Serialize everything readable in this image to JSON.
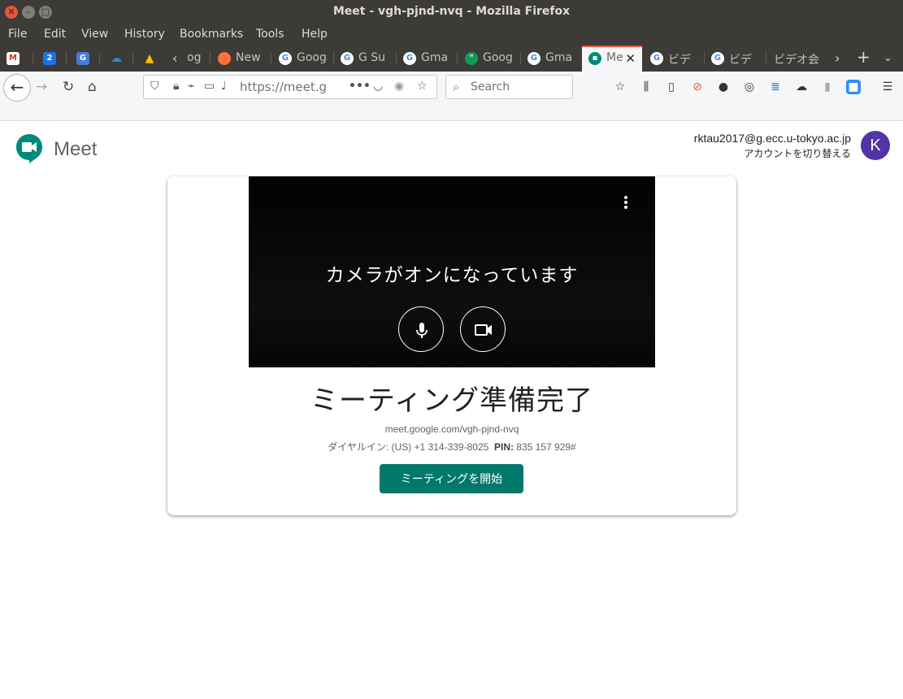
{
  "window": {
    "title": "Meet - vgh-pjnd-nvq - Mozilla Firefox"
  },
  "menu": [
    "File",
    "Edit",
    "View",
    "History",
    "Bookmarks",
    "Tools",
    "Help"
  ],
  "tabs": [
    {
      "icon": "gmail-icon",
      "label": ""
    },
    {
      "icon": "calendar-icon",
      "label": "2"
    },
    {
      "icon": "translate-icon",
      "label": ""
    },
    {
      "icon": "onedrive-icon",
      "label": ""
    },
    {
      "icon": "drive-icon",
      "label": ""
    },
    {
      "icon": "chevron-left-icon",
      "label": "og"
    },
    {
      "icon": "firefox-icon",
      "label": "New"
    },
    {
      "icon": "google-icon",
      "label": "Goog"
    },
    {
      "icon": "google-icon",
      "label": "G Su"
    },
    {
      "icon": "google-icon",
      "label": "Gma"
    },
    {
      "icon": "hangouts-icon",
      "label": "Goog"
    },
    {
      "icon": "google-icon",
      "label": "Gma"
    },
    {
      "icon": "meet-icon",
      "label": "Me"
    },
    {
      "icon": "google-icon",
      "label": "ビデ"
    },
    {
      "icon": "google-icon",
      "label": "ビデ"
    },
    {
      "icon": "",
      "label": "ビデオ会"
    }
  ],
  "navbar": {
    "url": "https://meet.g",
    "search_placeholder": "Search"
  },
  "meet": {
    "brand": "Meet",
    "account_email": "rktau2017@g.ecc.u-tokyo.ac.jp",
    "switch_account": "アカウントを切り替える",
    "avatar_letter": "K",
    "camera_status": "カメラがオンになっています",
    "ready_title": "ミーティング準備完了",
    "meeting_link": "meet.google.com/vgh-pjnd-nvq",
    "dialin_label": "ダイヤルイン: (US) +1 314-339-8025",
    "pin_label": "PIN:",
    "pin_value": "835 157 929#",
    "start_button": "ミーティングを開始"
  },
  "colors": {
    "accent": "#00796b",
    "avatar": "#5234a8",
    "chrome_dark": "#3c3b37"
  }
}
